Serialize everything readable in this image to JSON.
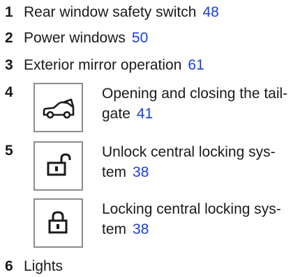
{
  "items": [
    {
      "number": "1",
      "label": "Rear window safety switch",
      "page": "48"
    },
    {
      "number": "2",
      "label": "Power windows",
      "page": "50"
    },
    {
      "number": "3",
      "label": "Exterior mirror operation",
      "page": "61"
    },
    {
      "number": "4",
      "line1": "Opening and closing the tail-",
      "line2": "gate",
      "page": "41",
      "icon": "car-tailgate-icon"
    },
    {
      "number": "5",
      "line1": "Unlock central locking sys-",
      "line2": "tem",
      "page": "38",
      "icon": "unlock-icon"
    },
    {
      "line1": "Locking central locking sys-",
      "line2": "tem",
      "page": "38",
      "icon": "lock-icon"
    },
    {
      "number": "6",
      "label": "Lights"
    }
  ],
  "colors": {
    "link": "#1a40d8",
    "text": "#1a1a1a",
    "icon_border": "#8c8c8c"
  }
}
